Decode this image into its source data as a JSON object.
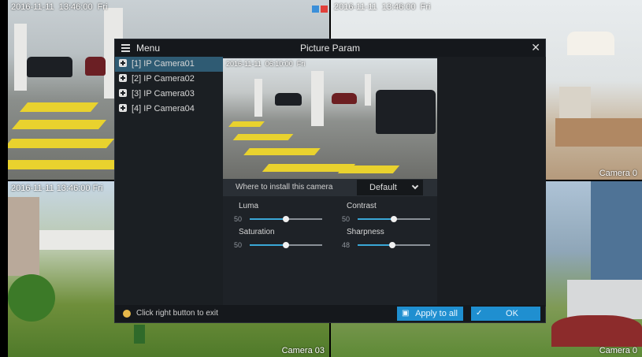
{
  "grid": {
    "tiles": [
      {
        "id": "tl",
        "osd": "2016-11-11  13:46:00  Fri",
        "label": ""
      },
      {
        "id": "tr",
        "osd": "2016-11-11  13:46:00  Fri",
        "label": "Camera 0"
      },
      {
        "id": "bl",
        "osd": "2016-11-11 13:46:00 Fri",
        "label": "Camera 03"
      },
      {
        "id": "br",
        "osd": "",
        "label": "Camera 0"
      }
    ]
  },
  "dialog": {
    "menu_label": "Menu",
    "title": "Picture Param",
    "close_icon": "close-icon",
    "cameras": [
      {
        "label": "[1] IP Camera01",
        "selected": true
      },
      {
        "label": "[2] IP Camera02",
        "selected": false
      },
      {
        "label": "[3] IP Camera03",
        "selected": false
      },
      {
        "label": "[4] IP Camera04",
        "selected": false
      }
    ],
    "preview_osd": "2016-11-11  06:10:00  Fri",
    "install": {
      "label": "Where to install this camera",
      "value": "Default"
    },
    "sliders": {
      "luma": {
        "label": "Luma",
        "value": "50",
        "level": 50
      },
      "contrast": {
        "label": "Contrast",
        "value": "50",
        "level": 50
      },
      "saturation": {
        "label": "Saturation",
        "value": "50",
        "level": 50
      },
      "sharpness": {
        "label": "Sharpness",
        "value": "48",
        "level": 48
      }
    },
    "footer": {
      "hint": "Click right button to exit",
      "apply_label": "Apply to all",
      "ok_label": "OK"
    }
  },
  "colors": {
    "accent": "#1f8fd0",
    "selected_row": "#2f5b73",
    "slider_fill": "#3aa7d6"
  }
}
